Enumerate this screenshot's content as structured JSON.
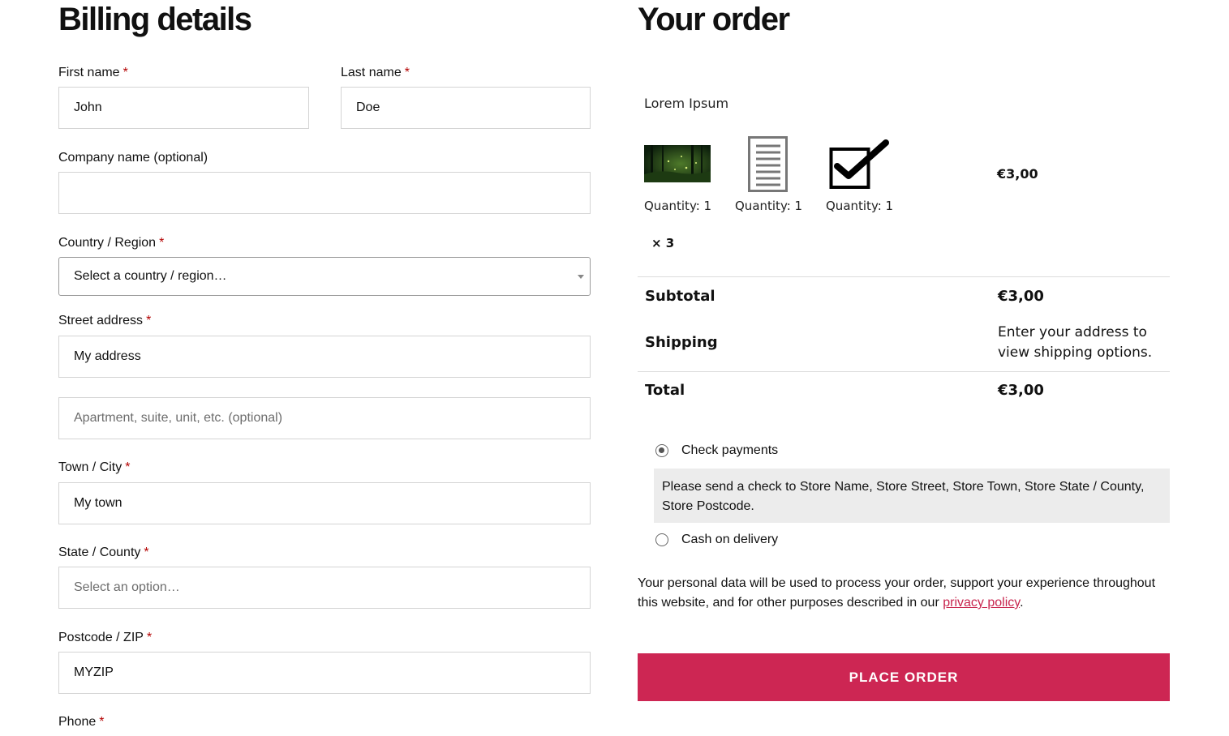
{
  "billing": {
    "title": "Billing details",
    "required_mark": "*",
    "first_name": {
      "label": "First name",
      "value": "John"
    },
    "last_name": {
      "label": "Last name",
      "value": "Doe"
    },
    "company": {
      "label": "Company name (optional)",
      "value": ""
    },
    "country": {
      "label": "Country / Region",
      "value": "Select a country / region…"
    },
    "street": {
      "label": "Street address",
      "value": "My address"
    },
    "apartment": {
      "placeholder": "Apartment, suite, unit, etc. (optional)"
    },
    "town": {
      "label": "Town / City",
      "value": "My town"
    },
    "state": {
      "label": "State / County",
      "placeholder": "Select an option…"
    },
    "postcode": {
      "label": "Postcode / ZIP",
      "value": "MYZIP"
    },
    "phone": {
      "label": "Phone"
    }
  },
  "order": {
    "title": "Your order",
    "product_name": "Lorem Ipsum",
    "items": [
      {
        "icon": "forest-image",
        "quantity": "Quantity: 1"
      },
      {
        "icon": "document-icon",
        "quantity": "Quantity: 1"
      },
      {
        "icon": "checkbox-checked-icon",
        "quantity": "Quantity: 1"
      }
    ],
    "multiplier": "× 3",
    "line_price": "€3,00",
    "subtotal_label": "Subtotal",
    "subtotal_value": "€3,00",
    "shipping_label": "Shipping",
    "shipping_text": "Enter your address to view shipping options.",
    "total_label": "Total",
    "total_value": "€3,00"
  },
  "payment": {
    "methods": [
      {
        "label": "Check payments",
        "selected": true
      },
      {
        "label": "Cash on delivery",
        "selected": false
      }
    ],
    "check_description": "Please send a check to Store Name, Store Street, Store Town, Store State / County, Store Postcode."
  },
  "privacy": {
    "text": "Your personal data will be used to process your order, support your experience throughout this website, and for other purposes described in our ",
    "link": "privacy policy",
    "end": "."
  },
  "place_order_label": "PLACE ORDER",
  "colors": {
    "accent": "#cd2653",
    "required": "#b30000",
    "description_bg": "#ececec"
  }
}
